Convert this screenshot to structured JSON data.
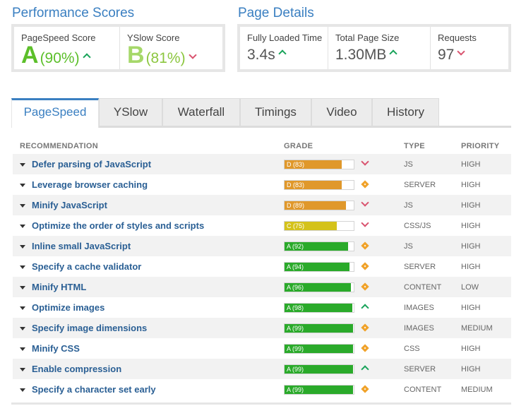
{
  "performance": {
    "title": "Performance Scores",
    "pagespeed": {
      "label": "PageSpeed Score",
      "grade": "A",
      "percent": "(90%)",
      "trend": "up"
    },
    "yslow": {
      "label": "YSlow Score",
      "grade": "B",
      "percent": "(81%)",
      "trend": "down"
    }
  },
  "details": {
    "title": "Page Details",
    "loaded": {
      "label": "Fully Loaded Time",
      "value": "3.4s",
      "trend": "up"
    },
    "size": {
      "label": "Total Page Size",
      "value": "1.30MB",
      "trend": "up"
    },
    "requests": {
      "label": "Requests",
      "value": "97",
      "trend": "down"
    }
  },
  "tabs": [
    "PageSpeed",
    "YSlow",
    "Waterfall",
    "Timings",
    "Video",
    "History"
  ],
  "active_tab": "PageSpeed",
  "table": {
    "headers": {
      "recommendation": "RECOMMENDATION",
      "grade": "GRADE",
      "type": "TYPE",
      "priority": "PRIORITY"
    },
    "rows": [
      {
        "name": "Defer parsing of JavaScript",
        "grade": "D (83)",
        "score": 83,
        "color": "#e0982b",
        "indicator": "down",
        "type": "JS",
        "priority": "HIGH"
      },
      {
        "name": "Leverage browser caching",
        "grade": "D (83)",
        "score": 83,
        "color": "#e0982b",
        "indicator": "diamond",
        "type": "SERVER",
        "priority": "HIGH"
      },
      {
        "name": "Minify JavaScript",
        "grade": "D (89)",
        "score": 89,
        "color": "#e0982b",
        "indicator": "down",
        "type": "JS",
        "priority": "HIGH"
      },
      {
        "name": "Optimize the order of styles and scripts",
        "grade": "C (75)",
        "score": 75,
        "color": "#d4c21a",
        "indicator": "down",
        "type": "CSS/JS",
        "priority": "HIGH"
      },
      {
        "name": "Inline small JavaScript",
        "grade": "A (92)",
        "score": 92,
        "color": "#2aaa2a",
        "indicator": "diamond",
        "type": "JS",
        "priority": "HIGH"
      },
      {
        "name": "Specify a cache validator",
        "grade": "A (94)",
        "score": 94,
        "color": "#2aaa2a",
        "indicator": "diamond",
        "type": "SERVER",
        "priority": "HIGH"
      },
      {
        "name": "Minify HTML",
        "grade": "A (96)",
        "score": 96,
        "color": "#2aaa2a",
        "indicator": "diamond",
        "type": "CONTENT",
        "priority": "LOW"
      },
      {
        "name": "Optimize images",
        "grade": "A (98)",
        "score": 98,
        "color": "#2aaa2a",
        "indicator": "up",
        "type": "IMAGES",
        "priority": "HIGH"
      },
      {
        "name": "Specify image dimensions",
        "grade": "A (99)",
        "score": 99,
        "color": "#2aaa2a",
        "indicator": "diamond",
        "type": "IMAGES",
        "priority": "MEDIUM"
      },
      {
        "name": "Minify CSS",
        "grade": "A (99)",
        "score": 99,
        "color": "#2aaa2a",
        "indicator": "diamond",
        "type": "CSS",
        "priority": "HIGH"
      },
      {
        "name": "Enable compression",
        "grade": "A (99)",
        "score": 99,
        "color": "#2aaa2a",
        "indicator": "up",
        "type": "SERVER",
        "priority": "HIGH"
      },
      {
        "name": "Specify a character set early",
        "grade": "A (99)",
        "score": 99,
        "color": "#2aaa2a",
        "indicator": "diamond",
        "type": "CONTENT",
        "priority": "MEDIUM"
      }
    ]
  }
}
